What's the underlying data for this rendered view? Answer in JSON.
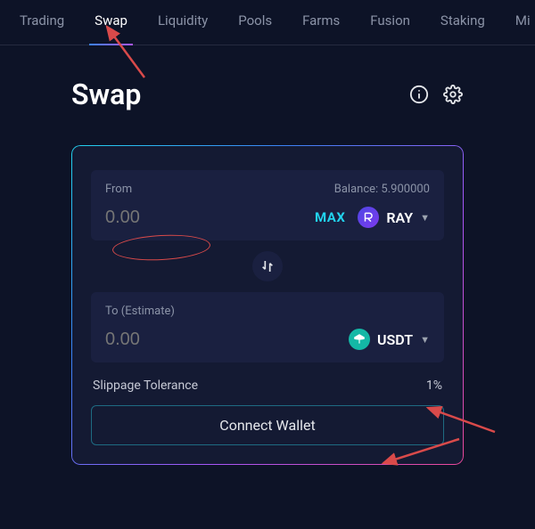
{
  "nav": {
    "items": [
      {
        "label": "Trading",
        "active": false
      },
      {
        "label": "Swap",
        "active": true
      },
      {
        "label": "Liquidity",
        "active": false
      },
      {
        "label": "Pools",
        "active": false
      },
      {
        "label": "Farms",
        "active": false
      },
      {
        "label": "Fusion",
        "active": false
      },
      {
        "label": "Staking",
        "active": false
      },
      {
        "label": "Mi",
        "active": false
      }
    ]
  },
  "page": {
    "title": "Swap"
  },
  "swap": {
    "from": {
      "label": "From",
      "balance_label": "Balance:",
      "balance": "5.900000",
      "amount_placeholder": "0.00",
      "max_label": "MAX",
      "token": "RAY"
    },
    "to": {
      "label": "To (Estimate)",
      "amount_placeholder": "0.00",
      "token": "USDT"
    },
    "slippage": {
      "label": "Slippage Tolerance",
      "value": "1%"
    },
    "connect_button": "Connect Wallet"
  }
}
